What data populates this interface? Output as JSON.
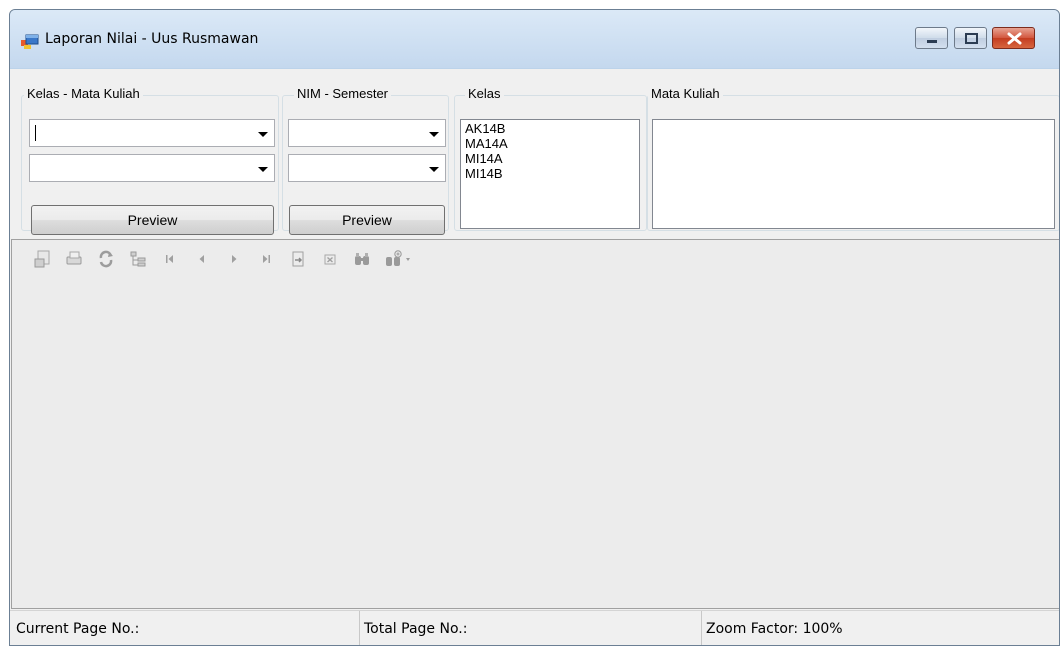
{
  "window": {
    "title": "Laporan Nilai - Uus Rusmawan",
    "controls": [
      "minimize-icon",
      "maximize-icon",
      "close-icon"
    ]
  },
  "kelas_mk_group": {
    "title": "Kelas - Mata Kuliah",
    "combo1_value": "",
    "combo2_value": "",
    "preview_label": "Preview"
  },
  "nim_sem_group": {
    "title": "NIM - Semester",
    "combo1_value": "",
    "combo2_value": "",
    "preview_label": "Preview"
  },
  "kelas_group": {
    "title": "Kelas",
    "items": [
      "AK14B",
      "MA14A",
      "MI14A",
      "MI14B"
    ]
  },
  "mk_group": {
    "title": "Mata Kuliah",
    "items": []
  },
  "toolbar": {
    "icons": [
      "export-icon",
      "print-icon",
      "refresh-icon",
      "group-tree-icon",
      "first-page-icon",
      "previous-page-icon",
      "next-page-icon",
      "last-page-icon",
      "go-to-page-icon",
      "stop-icon",
      "search-icon",
      "zoom-icon"
    ]
  },
  "statusbar": {
    "current_page": "Current Page No.:",
    "total_page": "Total Page No.:",
    "zoom": "Zoom Factor: 100%"
  }
}
